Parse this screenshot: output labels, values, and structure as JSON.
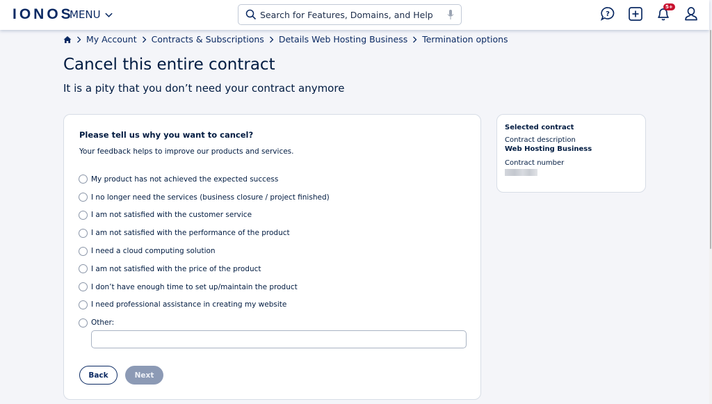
{
  "header": {
    "logo": "IONOS",
    "menu_label": "MENU",
    "search_placeholder": "Search for Features, Domains, and Help",
    "notifications_badge": "5+"
  },
  "breadcrumb": {
    "items": [
      "My Account",
      "Contracts & Subscriptions",
      "Details Web Hosting Business",
      "Termination options"
    ]
  },
  "page": {
    "title": "Cancel this entire contract",
    "subtitle": "It is a pity that you don’t need your contract anymore"
  },
  "form": {
    "question": "Please tell us why you want to cancel?",
    "helper": "Your feedback helps to improve our products and services.",
    "options": [
      "My product has not achieved the expected success",
      "I no longer need the services (business closure / project finished)",
      "I am not satisfied with the customer service",
      "I am not satisfied with the performance of the product",
      "I need a cloud computing solution",
      "I am not satisfied with the price of the product",
      "I don’t have enough time to set up/maintain the product",
      "I need professional assistance in creating my website",
      "Other:"
    ],
    "other_value": "",
    "back_label": "Back",
    "next_label": "Next"
  },
  "sidebar": {
    "heading": "Selected contract",
    "description_label": "Contract description",
    "description_value": "Web Hosting Business",
    "number_label": "Contract number"
  }
}
